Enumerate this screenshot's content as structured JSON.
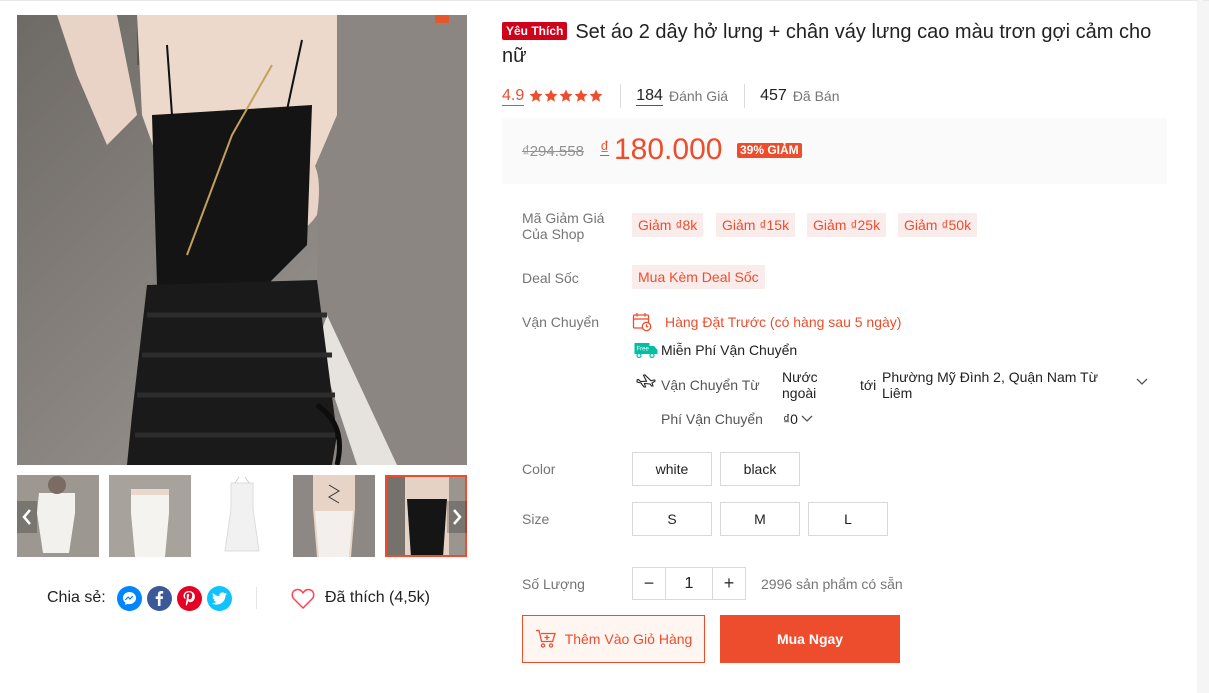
{
  "product": {
    "badge": "Yêu Thích",
    "title": "Set áo 2 dây hở lưng + chân váy lưng cao màu trơn gợi cảm cho nữ",
    "rating": "4.9",
    "rating_stars": 5,
    "reviews_count": "184",
    "reviews_label": "Đánh Giá",
    "sold_count": "457",
    "sold_label": "Đã Bán"
  },
  "price": {
    "original": "₫294.558",
    "currency": "₫",
    "current": "180.000",
    "discount": "39% GIẢM"
  },
  "vouchers": {
    "label": "Mã Giảm Giá Của Shop",
    "items": [
      "Giảm ₫8k",
      "Giảm ₫15k",
      "Giảm ₫25k",
      "Giảm ₫50k"
    ]
  },
  "deal": {
    "label": "Deal Sốc",
    "value": "Mua Kèm Deal Sốc"
  },
  "shipping": {
    "label": "Vận Chuyển",
    "preorder": "Hàng Đặt Trước (có hàng sau 5 ngày)",
    "free_ship_tag": "Free",
    "free": "Miễn Phí Vận Chuyển",
    "from_label": "Vận Chuyển Từ",
    "from_value": "Nước ngoài",
    "to_label": "tới",
    "to_value": "Phường Mỹ Đình 2, Quận Nam Từ Liêm",
    "fee_label": "Phí Vận Chuyển",
    "fee_value": "₫0"
  },
  "color": {
    "label": "Color",
    "options": [
      "white",
      "black"
    ]
  },
  "size": {
    "label": "Size",
    "options": [
      "S",
      "M",
      "L"
    ]
  },
  "quantity": {
    "label": "Số Lượng",
    "value": "1",
    "minus": "−",
    "plus": "+",
    "stock": "2996 sản phẩm có sẵn"
  },
  "actions": {
    "add_to_cart": "Thêm Vào Giỏ Hàng",
    "buy_now": "Mua Ngay"
  },
  "share": {
    "label": "Chia sẻ:",
    "icons": [
      "messenger-icon",
      "facebook-icon",
      "pinterest-icon",
      "twitter-icon"
    ]
  },
  "like": {
    "label": "Đã thích (4,5k)"
  },
  "colors": {
    "accent": "#ee4d2d",
    "badge": "#d0011b",
    "voucher_bg": "#fbecec"
  }
}
